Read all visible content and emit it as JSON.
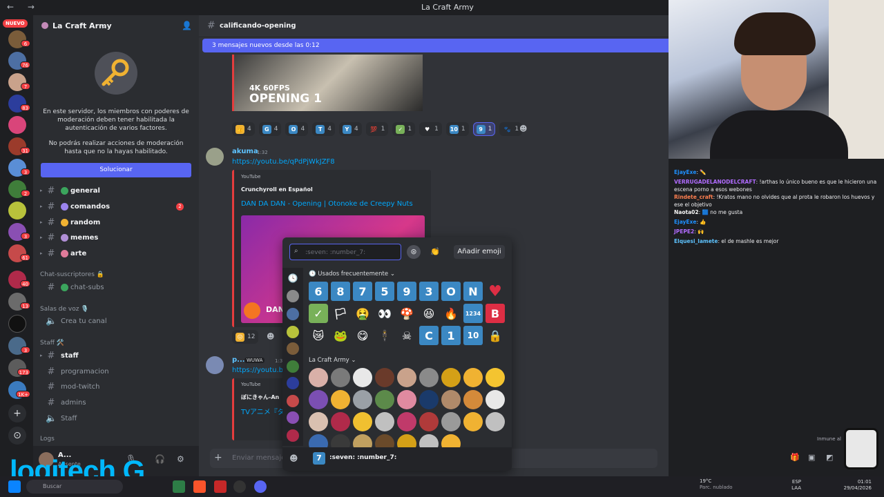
{
  "window": {
    "title": "La Craft Army",
    "nav": "← →"
  },
  "rail": {
    "nuevo": "NUEVO",
    "badges": [
      "6",
      "76",
      "7",
      "83",
      "31",
      "3",
      "2",
      "3",
      "61",
      "40",
      "13",
      "3",
      "173",
      "3",
      "1K+"
    ]
  },
  "server": {
    "name": "La Craft Army",
    "mod_msg_1": "En este servidor, los miembros con poderes de moderación deben tener habilitada la autenticación de varios factores.",
    "mod_msg_2": "No podrás realizar acciones de moderación hasta que no la hayas habilitado.",
    "solve_btn": "Solucionar",
    "channels": [
      {
        "label": "general",
        "color": "#3ba55d"
      },
      {
        "label": "comandos",
        "color": "#9b84ee",
        "count": "2"
      },
      {
        "label": "random",
        "color": "#f0b232"
      },
      {
        "label": "memes",
        "color": "#b08fd6"
      },
      {
        "label": "arte",
        "color": "#e07b9a"
      }
    ],
    "cat_subs": "Chat-suscriptores 🔒",
    "chat_subs": "chat-subs",
    "cat_voice": "Salas de voz 🎙️",
    "create_channel": "Crea tu canal",
    "cat_staff": "Staff 🛠️",
    "staff_channels": [
      "staff",
      "programacion",
      "mod-twitch",
      "admins",
      "Staff"
    ],
    "cat_logs": "Logs",
    "user": {
      "name": "A...",
      "status": "Ausente"
    }
  },
  "chat": {
    "channel": "calificando-opening",
    "new_msgs": "3 mensajes nuevos desde las 0:12",
    "video1_top": "4K 60FPS",
    "video1_title": "OPENING 1",
    "reactions": [
      {
        "e": "👍",
        "n": "4",
        "bg": "#f0b232"
      },
      {
        "e": "G",
        "n": "4",
        "bg": "#3b88c3"
      },
      {
        "e": "O",
        "n": "4",
        "bg": "#3b88c3"
      },
      {
        "e": "T",
        "n": "4",
        "bg": "#3b88c3"
      },
      {
        "e": "Y",
        "n": "4",
        "bg": "#3b88c3"
      },
      {
        "e": "💯",
        "n": "1",
        "bg": "transparent"
      },
      {
        "e": "✓",
        "n": "1",
        "bg": "#78b159"
      },
      {
        "e": "♥",
        "n": "1",
        "bg": "transparent"
      },
      {
        "e": "10",
        "n": "1",
        "bg": "#3b88c3"
      },
      {
        "e": "9",
        "n": "1",
        "bg": "#3b88c3",
        "on": true
      },
      {
        "e": "🐾",
        "n": "1",
        "bg": "transparent"
      }
    ],
    "msg2": {
      "user": "akuma",
      "time": "1:32",
      "link": "https://youtu.be/qPdPjWkJZF8",
      "provider": "YouTube",
      "author": "Crunchyroll en Español",
      "title": "DAN DA DAN - Opening | Otonoke de Creepy Nuts",
      "thumb_text": "DAN",
      "react_count": "12"
    },
    "msg3": {
      "user": "p...",
      "tag": "WUWA",
      "time": "1:3",
      "link": "https://youtu.be...",
      "provider": "YouTube",
      "author": "ぼにきゃん-An",
      "title": "TVアニメ『ダ"
    },
    "composer_placeholder": "Enviar mensaje a"
  },
  "picker": {
    "search_placeholder": ":seven: :number_7:",
    "add_emoji": "Añadir emoji",
    "frequent_label": "Usados frecuentemente",
    "frequent_row1": [
      "6",
      "8",
      "7",
      "5",
      "9",
      "3",
      "O",
      "N",
      "♥"
    ],
    "frequent_row2": [
      "✓",
      "🏳",
      "🤮",
      "👀",
      "🍄",
      "😆",
      "🔥",
      "1234",
      "B"
    ],
    "frequent_row3": [
      "😿",
      "🐸",
      "😋",
      "🕴",
      "☠",
      "C",
      "1",
      "10",
      "🔒"
    ],
    "server_label": "La Craft Army",
    "footer_name": ":seven: :number_7:",
    "footer_key": "7"
  },
  "stream": {
    "chat": [
      {
        "u": "EjayExe",
        "c": "#1e90ff",
        "m": ": ✏️"
      },
      {
        "u": "VERRUGADELANODELCRAFT",
        "c": "#b16cff",
        "m": ": !arthas lo único bueno es que le hicieron una escena porno a esos webones"
      },
      {
        "u": "Rindete_craft",
        "c": "#ff7f50",
        "m": ": !Kratos mano no olvides que al prota le robaron los huevos y ese el objetivo"
      },
      {
        "u": "Naota02",
        "c": "#f5f5f5",
        "m": ": 🟦 no me gusta"
      },
      {
        "u": "EjayExe",
        "c": "#1e90ff",
        "m": ": 👍"
      },
      {
        "u": "JPEPE2",
        "c": "#b16cff",
        "m": ": 🙌"
      },
      {
        "u": "Elquesi_lamete",
        "c": "#5ec3ff",
        "m": ": el de mashle es mejor"
      }
    ],
    "immune": "Inmune al",
    "logo": "logitech G"
  },
  "taskbar": {
    "search": "Buscar",
    "temp": "19°C",
    "weather": "Parc. nublado",
    "lang1": "ESP",
    "lang2": "LAA",
    "time": "01:01",
    "date": "29/04/2026"
  }
}
